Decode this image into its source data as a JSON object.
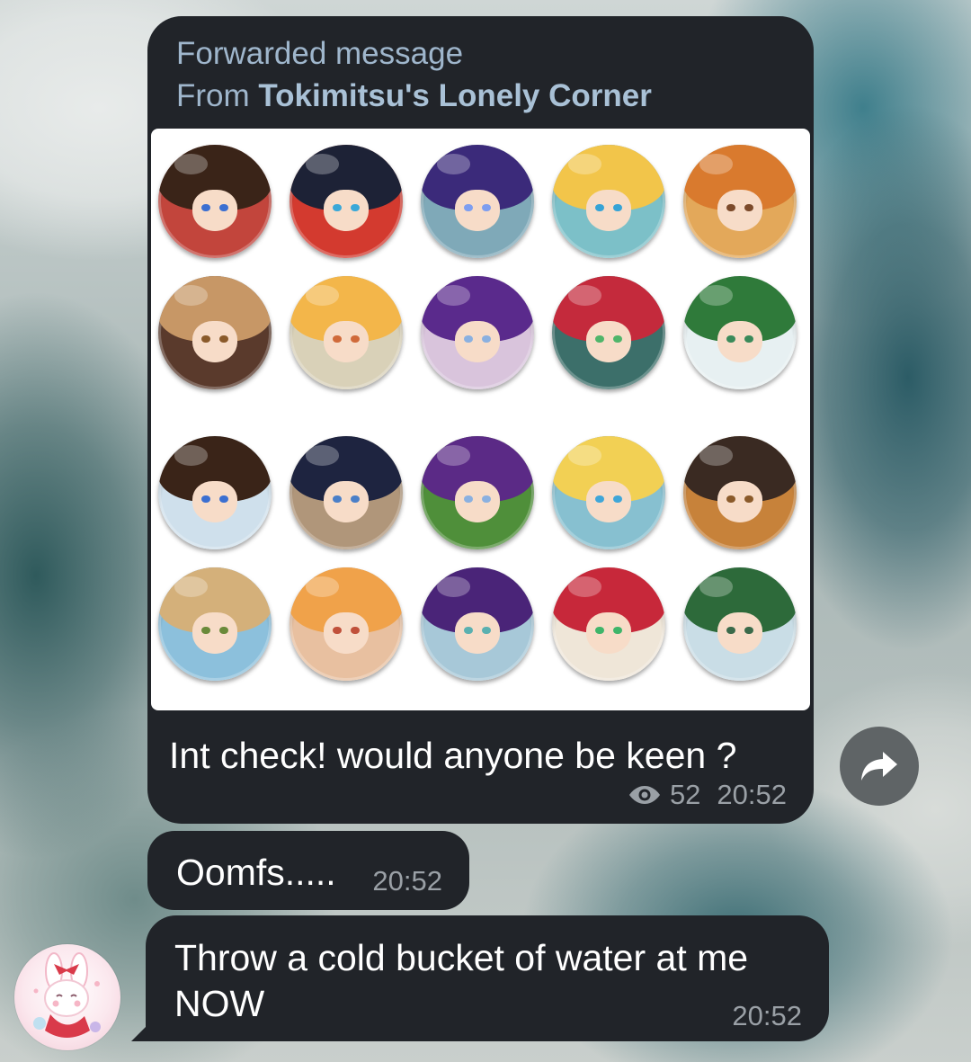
{
  "forwarded_post": {
    "header_label": "Forwarded message",
    "from_prefix": "From",
    "channel_name": "Tokimitsu's Lonely Corner",
    "message_text": "Int check! would anyone be keen ?",
    "views": "52",
    "time": "20:52",
    "view_icon": "eye-icon",
    "badges": [
      {
        "hair": "#3a2418",
        "bg": "#c2453c",
        "eyes": "#3b6fd1"
      },
      {
        "hair": "#1d2236",
        "bg": "#d33a2f",
        "eyes": "#3aa8d8"
      },
      {
        "hair": "#3b2a7a",
        "bg": "#7fa9b8",
        "eyes": "#7d9ef0"
      },
      {
        "hair": "#f2c54a",
        "bg": "#7cc0c8",
        "eyes": "#35a3d6"
      },
      {
        "hair": "#d97a2e",
        "bg": "#e3a85a",
        "eyes": "#7c4a2a"
      },
      {
        "hair": "#c79766",
        "bg": "#5a3a2c",
        "eyes": "#8a5a2a"
      },
      {
        "hair": "#f3b64a",
        "bg": "#d9d1b8",
        "eyes": "#d06a3a"
      },
      {
        "hair": "#5a2a8c",
        "bg": "#d9c4dc",
        "eyes": "#8ab0e0"
      },
      {
        "hair": "#c42a3c",
        "bg": "#3c6f6a",
        "eyes": "#4fb56a"
      },
      {
        "hair": "#2f7a3a",
        "bg": "#e7f0f2",
        "eyes": "#3a8a5a"
      },
      {
        "hair": "#3a2418",
        "bg": "#cfe0ec",
        "eyes": "#3b6fd1"
      },
      {
        "hair": "#1e2440",
        "bg": "#b0967a",
        "eyes": "#4a7fc8"
      },
      {
        "hair": "#5b2a86",
        "bg": "#4f8f3a",
        "eyes": "#8ab0e0"
      },
      {
        "hair": "#f2d054",
        "bg": "#87c0d0",
        "eyes": "#3fa6d8"
      },
      {
        "hair": "#3a2a22",
        "bg": "#c7823a",
        "eyes": "#8a5a2a"
      },
      {
        "hair": "#d4b07a",
        "bg": "#8cc0dc",
        "eyes": "#6a8a3a"
      },
      {
        "hair": "#f0a24a",
        "bg": "#e8c0a0",
        "eyes": "#c0503a"
      },
      {
        "hair": "#4a2478",
        "bg": "#a7c8d8",
        "eyes": "#5ab0b0"
      },
      {
        "hair": "#c7283a",
        "bg": "#efe6d8",
        "eyes": "#3fb56a"
      },
      {
        "hair": "#2d6a3a",
        "bg": "#c9dde6",
        "eyes": "#3a6a4a"
      }
    ]
  },
  "share_button": {
    "icon": "share-arrow-icon"
  },
  "message_oomfs": {
    "text": "Oomfs.....",
    "time": "20:52"
  },
  "message_throw": {
    "line1": "Throw a cold bucket of water at me",
    "line2": "NOW",
    "time": "20:52"
  },
  "sender_avatar": {
    "icon": "bunny-avatar-icon"
  },
  "colors": {
    "bubble": "#212429",
    "forward_header": "#9fb6cc",
    "meta_text": "#9aa0a6",
    "share_button": "#5f6466"
  }
}
